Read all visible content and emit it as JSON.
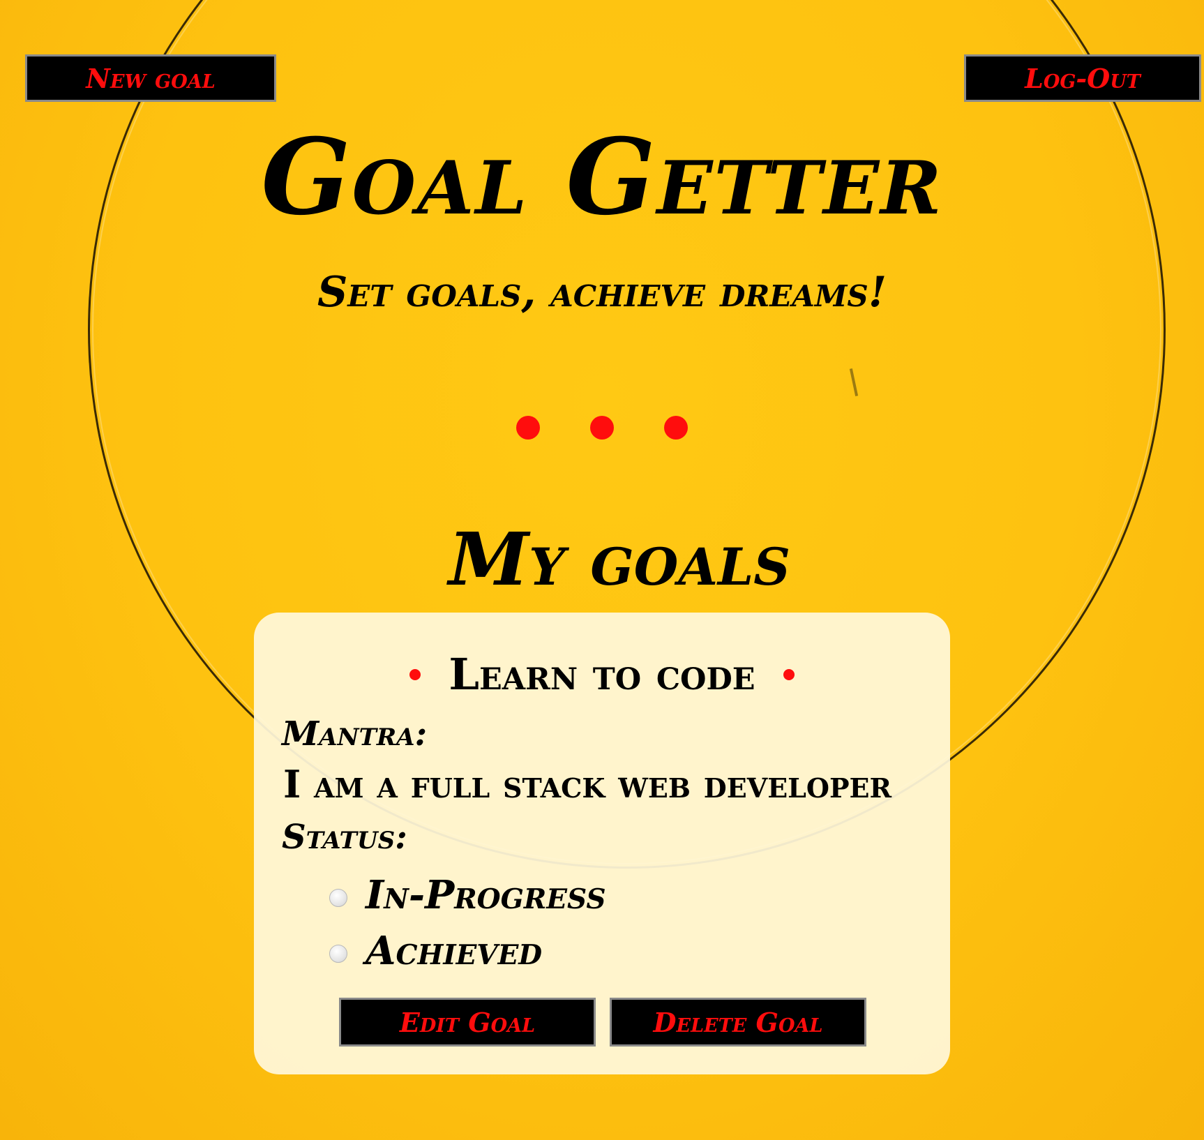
{
  "header": {
    "new_goal_label": "New goal",
    "logout_label": "Log-Out"
  },
  "hero": {
    "title": "Goal Getter",
    "subtitle": "Set goals, achieve dreams!"
  },
  "goals_section": {
    "title": "My goals",
    "goals": [
      {
        "title": "Learn to code",
        "mantra_label": "Mantra:",
        "mantra": "I am a full stack web developer",
        "status_label": "Status:",
        "status_options": [
          "In-Progress",
          "Achieved"
        ],
        "edit_label": "Edit Goal",
        "delete_label": "Delete Goal"
      }
    ]
  },
  "colors": {
    "background": "#fec210",
    "accent": "#ff0d0d",
    "button_bg": "#000000",
    "card_bg": "#fff8da"
  }
}
